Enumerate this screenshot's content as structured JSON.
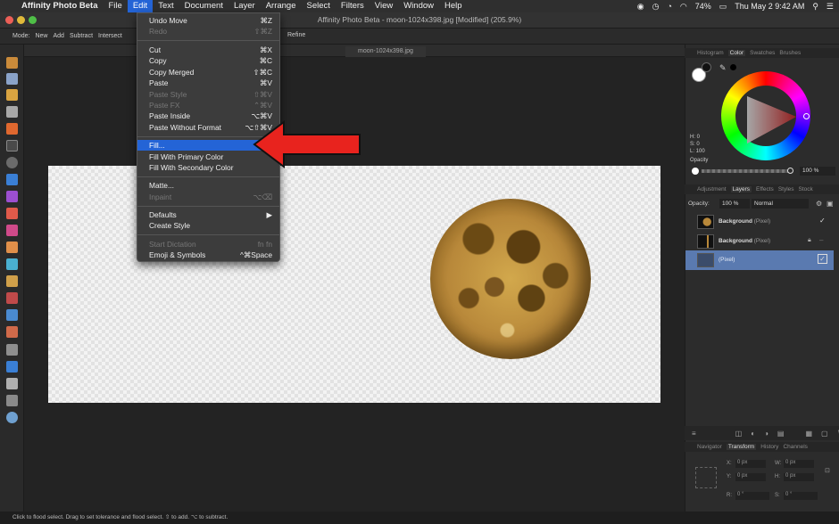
{
  "menubar": {
    "apple": "",
    "items": [
      "Affinity Photo Beta",
      "File",
      "Edit",
      "Text",
      "Document",
      "Layer",
      "Arrange",
      "Select",
      "Filters",
      "View",
      "Window",
      "Help"
    ],
    "battery": "74%",
    "datetime": "Thu May 2  9:42 AM"
  },
  "window": {
    "title": "Affinity Photo Beta - moon-1024x398.jpg [Modified] (205.9%)"
  },
  "context_toolbar": {
    "mode_label": "Mode:",
    "buttons": [
      "New",
      "Add",
      "Subtract",
      "Intersect"
    ],
    "refine": "Refine"
  },
  "document_tab": {
    "name": "moon-1024x398.jpg"
  },
  "edit_menu": {
    "items": [
      {
        "label": "Undo Move",
        "shortcut": "⌘Z"
      },
      {
        "label": "Redo",
        "shortcut": "⇧⌘Z"
      },
      {
        "label": "Cut",
        "shortcut": "⌘X"
      },
      {
        "label": "Copy",
        "shortcut": "⌘C"
      },
      {
        "label": "Copy Merged",
        "shortcut": "⇧⌘C"
      },
      {
        "label": "Paste",
        "shortcut": "⌘V"
      },
      {
        "label": "Paste Style",
        "shortcut": "⇧⌘V"
      },
      {
        "label": "Paste FX",
        "shortcut": "⌃⌘V"
      },
      {
        "label": "Paste Inside",
        "shortcut": "⌥⌘V"
      },
      {
        "label": "Paste Without Format",
        "shortcut": "⌥⇧⌘V"
      },
      {
        "label": "Fill...",
        "shortcut": ""
      },
      {
        "label": "Fill With Primary Color",
        "shortcut": ""
      },
      {
        "label": "Fill With Secondary Color",
        "shortcut": ""
      },
      {
        "label": "Matte...",
        "shortcut": ""
      },
      {
        "label": "Inpaint",
        "shortcut": "⌥⌫"
      },
      {
        "label": "Defaults",
        "shortcut": "▶"
      },
      {
        "label": "Create Style",
        "shortcut": ""
      },
      {
        "label": "Start Dictation",
        "shortcut": "fn fn"
      },
      {
        "label": "Emoji & Symbols",
        "shortcut": "^⌘Space"
      }
    ]
  },
  "color_panel": {
    "tabs": [
      "Histogram",
      "Color",
      "Swatches",
      "Brushes"
    ],
    "h": "H: 0",
    "s": "S: 0",
    "l": "L: 100",
    "opacity_label": "Opacity",
    "opacity_value": "100 %"
  },
  "layers_panel": {
    "tabs": [
      "Adjustment",
      "Layers",
      "Effects",
      "Styles",
      "Stock"
    ],
    "opacity_label": "Opacity:",
    "opacity_value": "100 %",
    "blend_mode": "Normal",
    "layers": [
      {
        "name": "Background",
        "type": "(Pixel)"
      },
      {
        "name": "Background",
        "type": "(Pixel)"
      },
      {
        "name": "",
        "type": "(Pixel)"
      }
    ]
  },
  "transform_panel": {
    "tabs": [
      "Navigator",
      "Transform",
      "History",
      "Channels"
    ],
    "x": "X:",
    "x_val": "0 px",
    "y": "Y:",
    "y_val": "0 px",
    "w": "W:",
    "w_val": "0 px",
    "h": "H:",
    "h_val": "0 px",
    "r": "R:",
    "r_val": "0 °",
    "s": "S:",
    "s_val": "0 °"
  },
  "status": {
    "text": "Click to flood select. Drag to set tolerance and flood select. ⇧ to add. ⌥ to subtract."
  },
  "colors": {
    "accent": "#2464d6",
    "arrow": "#e8231e"
  }
}
